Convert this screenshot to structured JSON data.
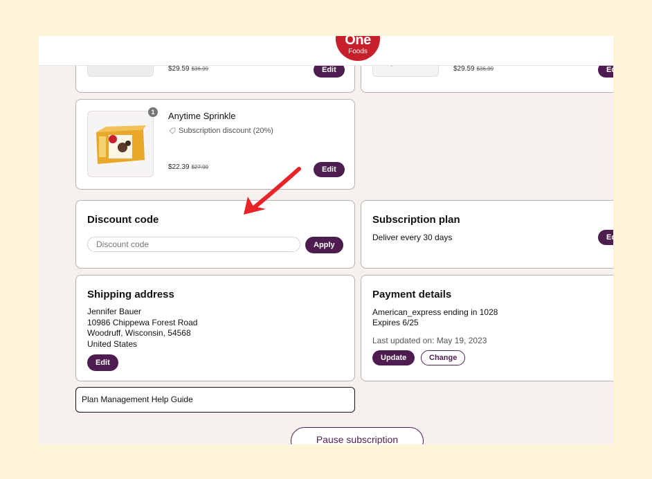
{
  "brand": {
    "logo_top": "One",
    "logo_bottom": "Foods"
  },
  "products": [
    {
      "price": "$29.59",
      "old_price": "$36.99",
      "edit": "Edit"
    },
    {
      "price": "$29.59",
      "old_price": "$36.99",
      "edit": "Ed"
    },
    {
      "name": "Anytime Sprinkle",
      "qty": "1",
      "discount": "Subscription discount (20%)",
      "price": "$22.39",
      "old_price": "$27.99",
      "edit": "Edit"
    }
  ],
  "discount": {
    "title": "Discount code",
    "placeholder": "Discount code",
    "apply": "Apply"
  },
  "plan": {
    "title": "Subscription plan",
    "text": "Deliver every 30 days",
    "edit": "Ed"
  },
  "shipping": {
    "title": "Shipping address",
    "lines": [
      "Jennifer Bauer",
      "10986 Chippewa Forest Road",
      "Woodruff, Wisconsin, 54568",
      "United States"
    ],
    "edit": "Edit"
  },
  "payment": {
    "title": "Payment details",
    "card": "American_express ending in 1028",
    "expires": "Expires 6/25",
    "updated": "Last updated on: May 19, 2023",
    "update": "Update",
    "change": "Change"
  },
  "help_link": "Plan Management Help Guide",
  "pause": "Pause subscription",
  "colors": {
    "accent": "#4e1d4f",
    "logo": "#c8202a",
    "arrow": "#e8232a",
    "outer_bg": "#fdf4da",
    "page_bg": "#f6f1ee"
  }
}
